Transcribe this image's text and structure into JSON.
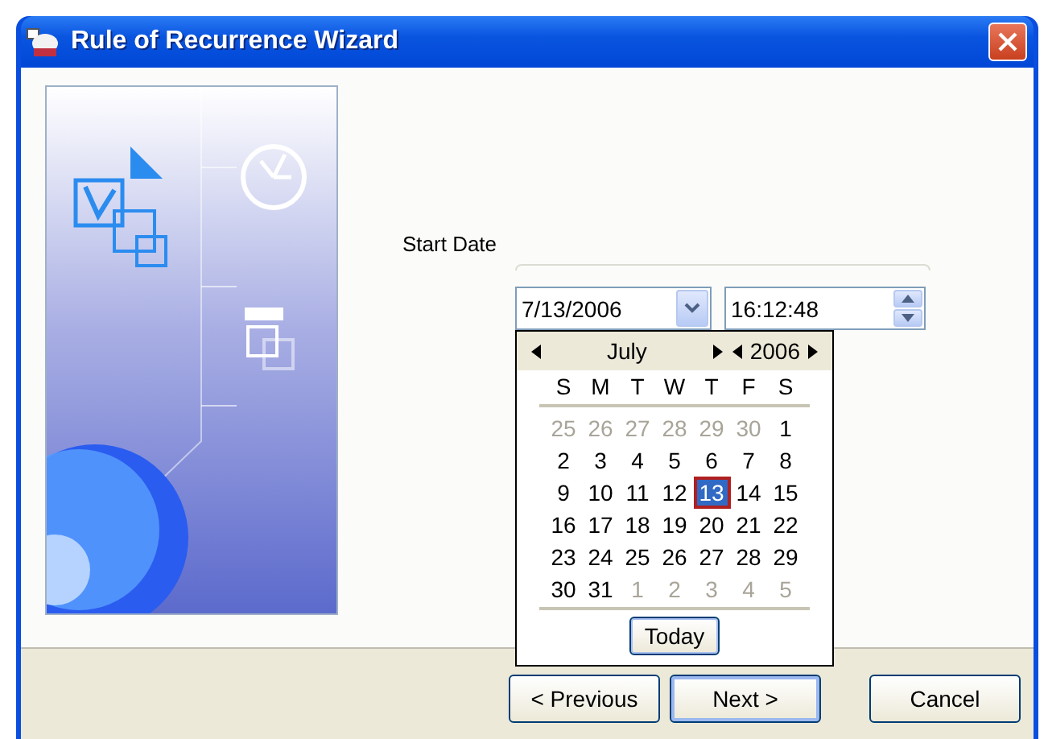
{
  "window": {
    "title": "Rule of Recurrence Wizard"
  },
  "start_date": {
    "label": "Start Date",
    "date_value": "7/13/2006",
    "time_value": "16:12:48"
  },
  "calendar": {
    "month": "July",
    "year": "2006",
    "weekdays": [
      "S",
      "M",
      "T",
      "W",
      "T",
      "F",
      "S"
    ],
    "weeks": [
      [
        {
          "day": "25",
          "other_month": true,
          "selected": false
        },
        {
          "day": "26",
          "other_month": true,
          "selected": false
        },
        {
          "day": "27",
          "other_month": true,
          "selected": false
        },
        {
          "day": "28",
          "other_month": true,
          "selected": false
        },
        {
          "day": "29",
          "other_month": true,
          "selected": false
        },
        {
          "day": "30",
          "other_month": true,
          "selected": false
        },
        {
          "day": "1",
          "other_month": false,
          "selected": false
        }
      ],
      [
        {
          "day": "2",
          "other_month": false,
          "selected": false
        },
        {
          "day": "3",
          "other_month": false,
          "selected": false
        },
        {
          "day": "4",
          "other_month": false,
          "selected": false
        },
        {
          "day": "5",
          "other_month": false,
          "selected": false
        },
        {
          "day": "6",
          "other_month": false,
          "selected": false
        },
        {
          "day": "7",
          "other_month": false,
          "selected": false
        },
        {
          "day": "8",
          "other_month": false,
          "selected": false
        }
      ],
      [
        {
          "day": "9",
          "other_month": false,
          "selected": false
        },
        {
          "day": "10",
          "other_month": false,
          "selected": false
        },
        {
          "day": "11",
          "other_month": false,
          "selected": false
        },
        {
          "day": "12",
          "other_month": false,
          "selected": false
        },
        {
          "day": "13",
          "other_month": false,
          "selected": true
        },
        {
          "day": "14",
          "other_month": false,
          "selected": false
        },
        {
          "day": "15",
          "other_month": false,
          "selected": false
        }
      ],
      [
        {
          "day": "16",
          "other_month": false,
          "selected": false
        },
        {
          "day": "17",
          "other_month": false,
          "selected": false
        },
        {
          "day": "18",
          "other_month": false,
          "selected": false
        },
        {
          "day": "19",
          "other_month": false,
          "selected": false
        },
        {
          "day": "20",
          "other_month": false,
          "selected": false
        },
        {
          "day": "21",
          "other_month": false,
          "selected": false
        },
        {
          "day": "22",
          "other_month": false,
          "selected": false
        }
      ],
      [
        {
          "day": "23",
          "other_month": false,
          "selected": false
        },
        {
          "day": "24",
          "other_month": false,
          "selected": false
        },
        {
          "day": "25",
          "other_month": false,
          "selected": false
        },
        {
          "day": "26",
          "other_month": false,
          "selected": false
        },
        {
          "day": "27",
          "other_month": false,
          "selected": false
        },
        {
          "day": "28",
          "other_month": false,
          "selected": false
        },
        {
          "day": "29",
          "other_month": false,
          "selected": false
        }
      ],
      [
        {
          "day": "30",
          "other_month": false,
          "selected": false
        },
        {
          "day": "31",
          "other_month": false,
          "selected": false
        },
        {
          "day": "1",
          "other_month": true,
          "selected": false
        },
        {
          "day": "2",
          "other_month": true,
          "selected": false
        },
        {
          "day": "3",
          "other_month": true,
          "selected": false
        },
        {
          "day": "4",
          "other_month": true,
          "selected": false
        },
        {
          "day": "5",
          "other_month": true,
          "selected": false
        }
      ]
    ],
    "today_button": "Today"
  },
  "buttons": [
    {
      "label": "< Previous",
      "kind": "normal"
    },
    {
      "label": "Next >",
      "kind": "default"
    },
    {
      "label": "Cancel",
      "kind": "cancel"
    }
  ]
}
